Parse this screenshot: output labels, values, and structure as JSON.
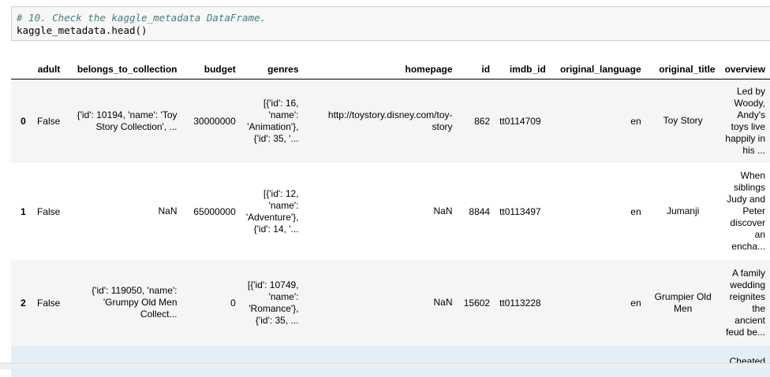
{
  "code": {
    "comment": "# 10. Check the kaggle_metadata DataFrame.",
    "statement": "kaggle_metadata.head()"
  },
  "table": {
    "columns": [
      "",
      "adult",
      "belongs_to_collection",
      "budget",
      "genres",
      "homepage",
      "id",
      "imdb_id",
      "original_language",
      "original_title",
      "overview"
    ],
    "rows": [
      {
        "index": "0",
        "adult": "False",
        "belongs_to_collection": "{'id': 10194, 'name': 'Toy Story Collection', ...",
        "budget": "30000000",
        "genres": "[{'id': 16, 'name': 'Animation'}, {'id': 35, '...",
        "homepage": "http://toystory.disney.com/toy-story",
        "id": "862",
        "imdb_id": "tt0114709",
        "original_language": "en",
        "original_title": "Toy Story",
        "overview": "Led by Woody, Andy's toys live happily in his ..."
      },
      {
        "index": "1",
        "adult": "False",
        "belongs_to_collection": "NaN",
        "budget": "65000000",
        "genres": "[{'id': 12, 'name': 'Adventure'}, {'id': 14, '...",
        "homepage": "NaN",
        "id": "8844",
        "imdb_id": "tt0113497",
        "original_language": "en",
        "original_title": "Jumanji",
        "overview": "When siblings Judy and Peter discover an encha..."
      },
      {
        "index": "2",
        "adult": "False",
        "belongs_to_collection": "{'id': 119050, 'name': 'Grumpy Old Men Collect...",
        "budget": "0",
        "genres": "[{'id': 10749, 'name': 'Romance'}, {'id': 35, ...",
        "homepage": "NaN",
        "id": "15602",
        "imdb_id": "tt0113228",
        "original_language": "en",
        "original_title": "Grumpier Old Men",
        "overview": "A family wedding reignites the ancient feud be..."
      },
      {
        "index": "",
        "adult": "",
        "belongs_to_collection": "",
        "budget": "",
        "genres": "",
        "homepage": "",
        "id": "",
        "imdb_id": "",
        "original_language": "",
        "original_title": "",
        "overview": "Cheated"
      }
    ]
  }
}
